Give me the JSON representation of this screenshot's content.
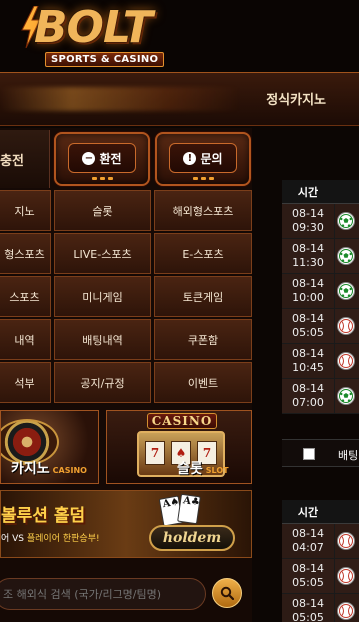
{
  "brand": {
    "name": "BOLT",
    "tagline": "SPORTS & CASINO"
  },
  "nav": {
    "current": "정식카지노"
  },
  "top_buttons": {
    "charge": "충전",
    "exchange": "환전",
    "inquiry": "문의"
  },
  "menu": [
    [
      "지노",
      "슬롯",
      "해외형스포츠"
    ],
    [
      "형스포츠",
      "LIVE-스포츠",
      "E-스포츠"
    ],
    [
      "스포츠",
      "미니게임",
      "토큰게임"
    ],
    [
      "내역",
      "배팅내역",
      "쿠폰함"
    ],
    [
      "석부",
      "공지/규정",
      "이벤트"
    ]
  ],
  "banners": {
    "casino": {
      "title": "카지노",
      "en": "CASINO"
    },
    "slot": {
      "title": "슬롯",
      "en": "SLOT",
      "sign": "CASINO"
    },
    "holdem": {
      "title": "볼루션 홀덤",
      "sub_prefix": "어 VS ",
      "sub_highlight": "플레이어 한판승부!",
      "logo": "holdem"
    }
  },
  "search": {
    "placeholder": "조 해외식 검색 (국가/리그명/팀명)"
  },
  "schedule1": {
    "header": "시간",
    "rows": [
      {
        "date": "08-14",
        "time": "09:30",
        "sport": "soccer"
      },
      {
        "date": "08-14",
        "time": "11:30",
        "sport": "soccer"
      },
      {
        "date": "08-14",
        "time": "10:00",
        "sport": "soccer"
      },
      {
        "date": "08-14",
        "time": "05:05",
        "sport": "baseball"
      },
      {
        "date": "08-14",
        "time": "10:45",
        "sport": "baseball"
      },
      {
        "date": "08-14",
        "time": "07:00",
        "sport": "soccer"
      }
    ]
  },
  "bet_label": "배팅",
  "schedule2": {
    "header": "시간",
    "rows": [
      {
        "date": "08-14",
        "time": "04:07",
        "sport": "baseball"
      },
      {
        "date": "08-14",
        "time": "05:05",
        "sport": "baseball"
      },
      {
        "date": "08-14",
        "time": "05:05",
        "sport": "baseball"
      }
    ]
  }
}
